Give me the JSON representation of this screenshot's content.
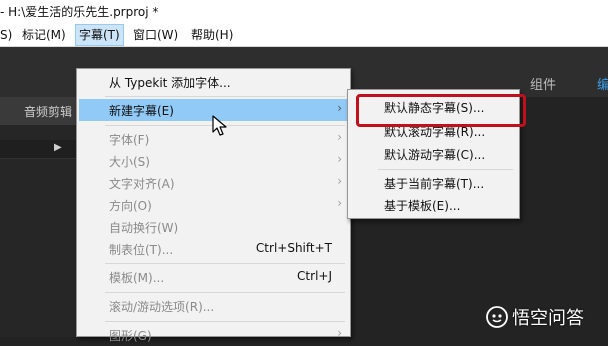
{
  "window": {
    "title": "- H:\\爱生活的乐先生.prproj *"
  },
  "menubar": {
    "items": [
      {
        "label": "S)"
      },
      {
        "label": "标记(M)"
      },
      {
        "label": "字幕(T)"
      },
      {
        "label": "窗口(W)"
      },
      {
        "label": "帮助(H)"
      }
    ]
  },
  "workspaces": {
    "component": "组件",
    "edit_partial": "编"
  },
  "panel": {
    "tab_label": "音频剪辑"
  },
  "title_menu": {
    "items": [
      {
        "label": "从 Typekit 添加字体...",
        "shortcut": "",
        "submenu": false,
        "disabled": false
      },
      {
        "label": "新建字幕(E)",
        "shortcut": "",
        "submenu": true,
        "disabled": false
      },
      {
        "label": "字体(F)",
        "shortcut": "",
        "submenu": true,
        "disabled": true
      },
      {
        "label": "大小(S)",
        "shortcut": "",
        "submenu": true,
        "disabled": true
      },
      {
        "label": "文字对齐(A)",
        "shortcut": "",
        "submenu": true,
        "disabled": true
      },
      {
        "label": "方向(O)",
        "shortcut": "",
        "submenu": true,
        "disabled": true
      },
      {
        "label": "自动换行(W)",
        "shortcut": "",
        "submenu": false,
        "disabled": true
      },
      {
        "label": "制表位(T)...",
        "shortcut": "Ctrl+Shift+T",
        "submenu": false,
        "disabled": true
      },
      {
        "label": "模板(M)...",
        "shortcut": "Ctrl+J",
        "submenu": false,
        "disabled": true
      },
      {
        "label": "滚动/游动选项(R)...",
        "shortcut": "",
        "submenu": false,
        "disabled": true
      },
      {
        "label": "图形(G)",
        "shortcut": "",
        "submenu": true,
        "disabled": true
      }
    ]
  },
  "new_title_submenu": {
    "items": [
      {
        "label": "默认静态字幕(S)..."
      },
      {
        "label": "默认滚动字幕(R)..."
      },
      {
        "label": "默认游动字幕(C)..."
      },
      {
        "label": "基于当前字幕(T)..."
      },
      {
        "label": "基于模板(E)..."
      }
    ]
  },
  "watermark": {
    "text": "悟空问答"
  },
  "colors": {
    "highlight": "#91c9f7",
    "annotation_box": "#c0101e",
    "accent": "#3b9ee8"
  },
  "icons": {
    "cursor": "arrow-pointer-icon",
    "submenu": "chevron-right-icon",
    "watermark_logo": "wukong-logo-icon"
  }
}
